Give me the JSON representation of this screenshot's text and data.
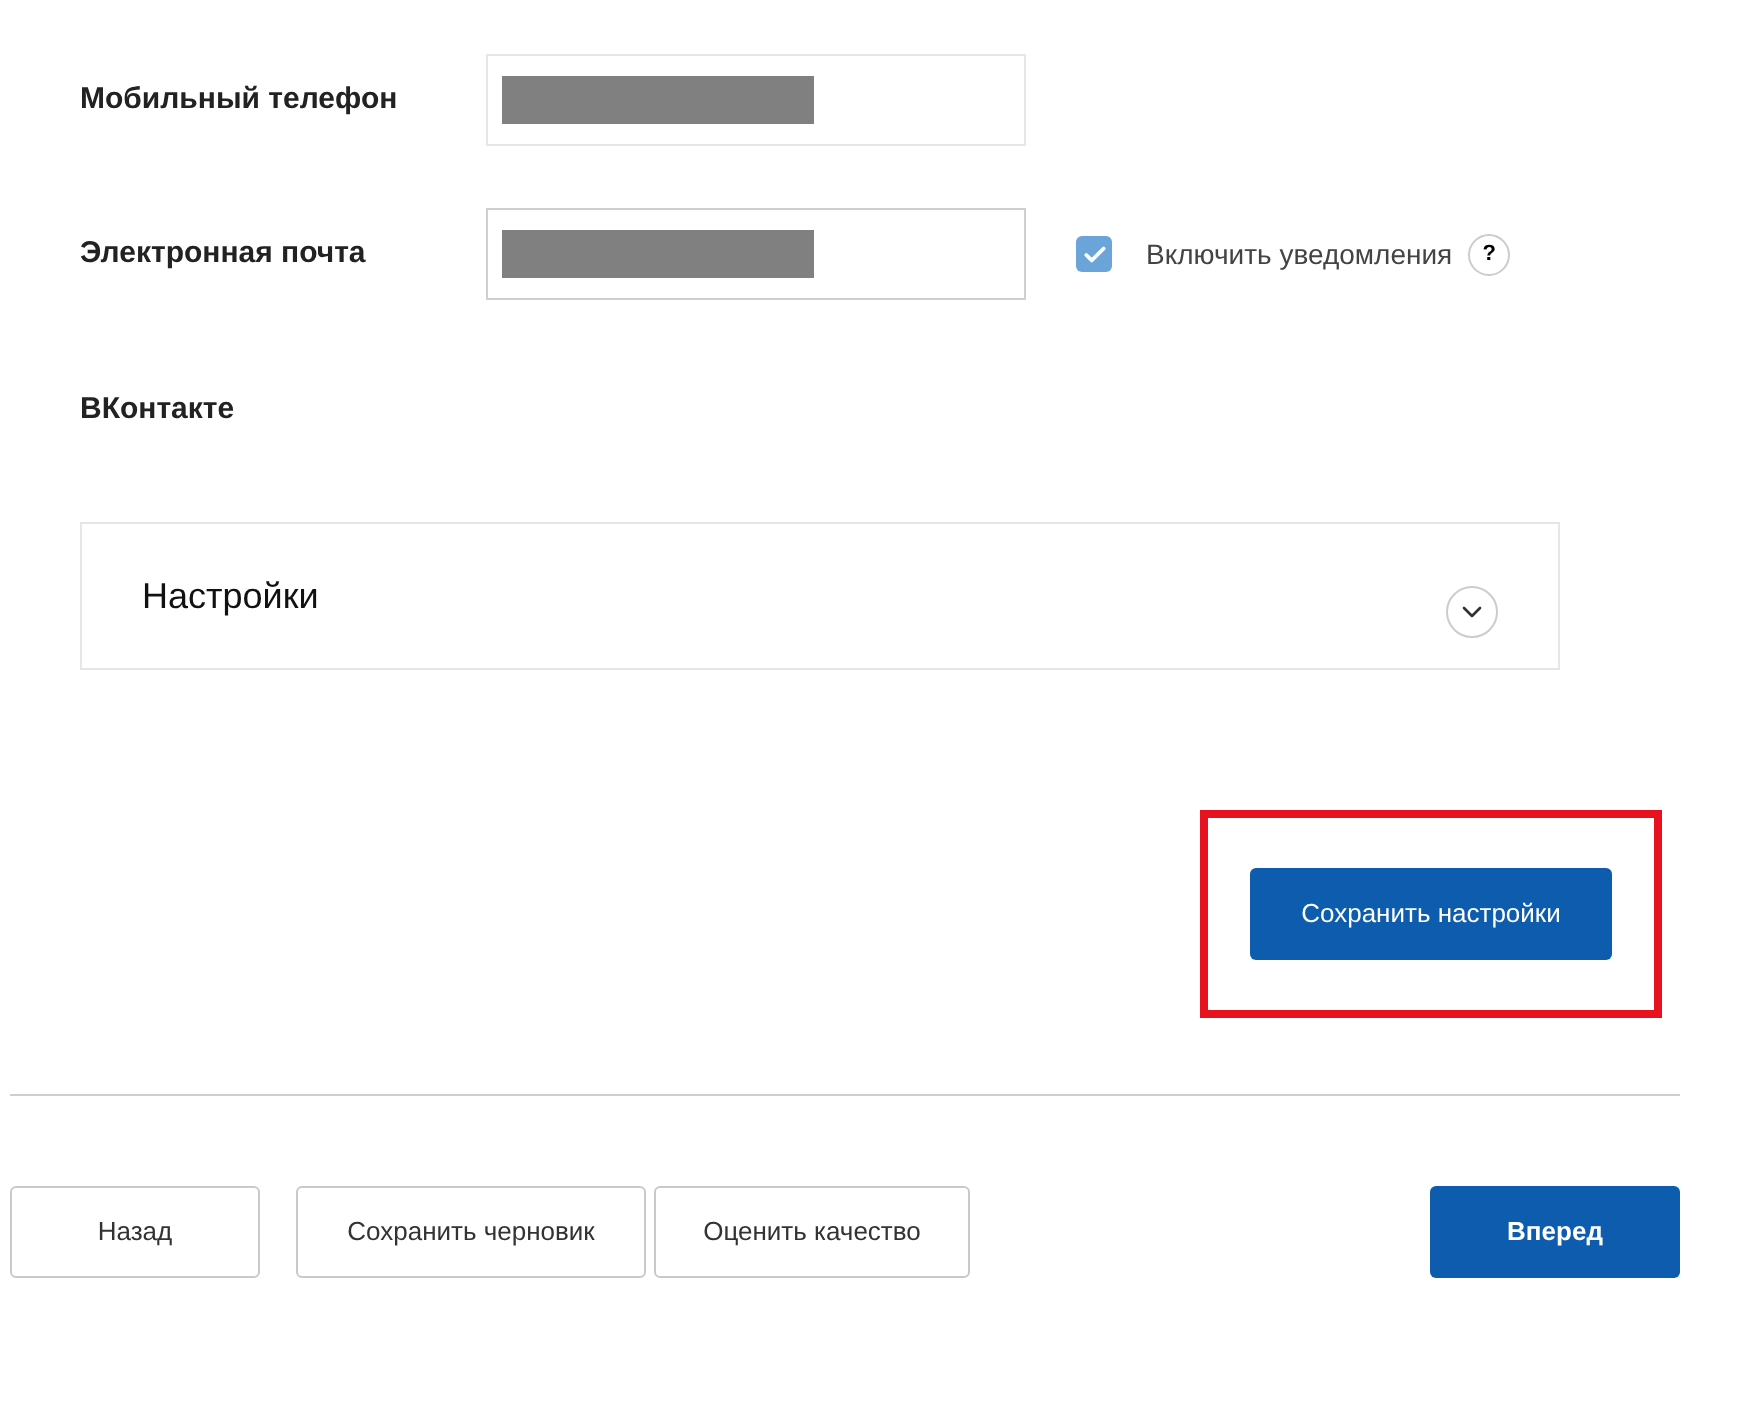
{
  "fields": [
    {
      "label": "Мобильный телефон",
      "redacted": true
    },
    {
      "label": "Электронная почта",
      "redacted": true,
      "notifications": {
        "label": "Включить уведомления",
        "checked": true,
        "help": "?"
      }
    }
  ],
  "vk_label": "ВКонтакте",
  "settings_panel": {
    "title": "Настройки",
    "expanded": false
  },
  "save_settings": {
    "label": "Сохранить настройки",
    "highlighted": true
  },
  "footer_buttons": [
    {
      "label": "Назад",
      "kind": "secondary"
    },
    {
      "label": "Сохранить черновик",
      "kind": "secondary"
    },
    {
      "label": "Оценить качество",
      "kind": "secondary"
    },
    {
      "label": "Вперед",
      "kind": "primary"
    }
  ]
}
